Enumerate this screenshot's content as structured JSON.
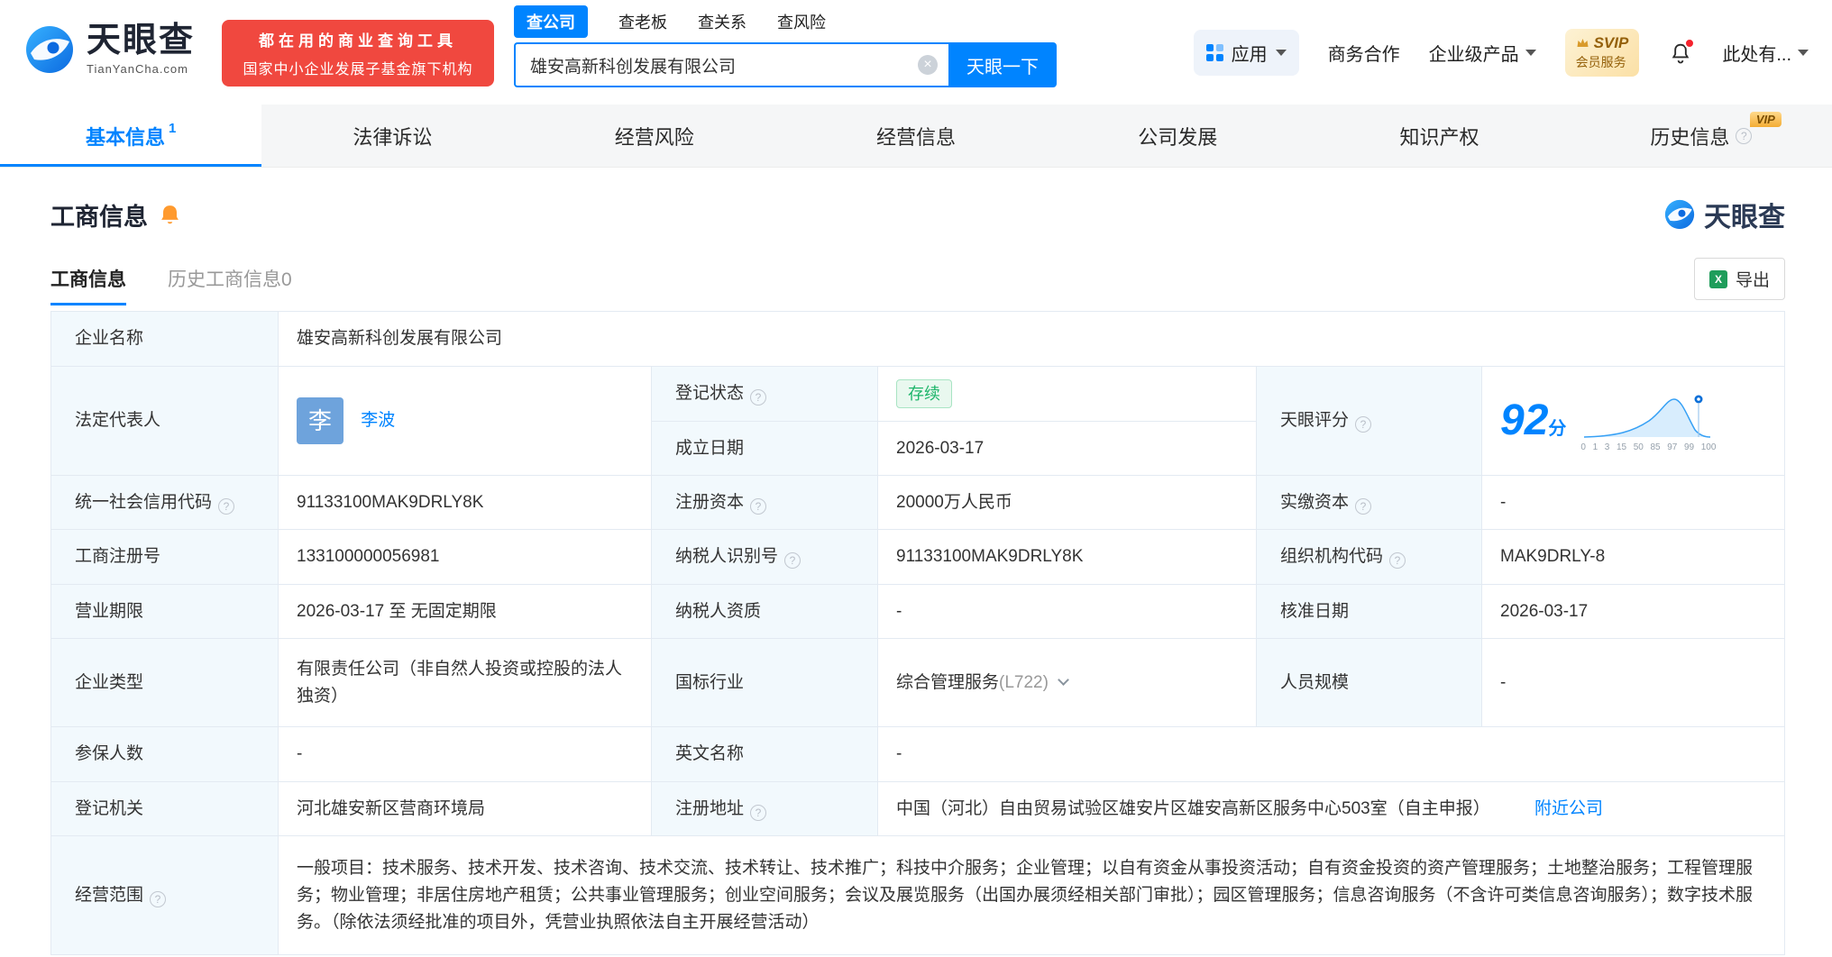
{
  "brand": {
    "name_cn": "天眼查",
    "name_en": "TianYanCha.com",
    "slogan_line1": "都在用的商业查询工具",
    "slogan_line2": "国家中小企业发展子基金旗下机构"
  },
  "search": {
    "tabs": [
      {
        "label": "查公司"
      },
      {
        "label": "查老板"
      },
      {
        "label": "查关系"
      },
      {
        "label": "查风险"
      }
    ],
    "value": "雄安高新科创发展有限公司",
    "button": "天眼一下"
  },
  "topnav": {
    "apps": "应用",
    "cooperation": "商务合作",
    "enterprise": "企业级产品",
    "svip_top": "SVIP",
    "svip_bottom": "会员服务",
    "user": "此处有..."
  },
  "tabs": {
    "items": [
      {
        "label": "基本信息",
        "count": "1"
      },
      {
        "label": "法律诉讼"
      },
      {
        "label": "经营风险"
      },
      {
        "label": "经营信息"
      },
      {
        "label": "公司发展"
      },
      {
        "label": "知识产权"
      },
      {
        "label": "历史信息",
        "vip": "VIP"
      }
    ]
  },
  "section": {
    "title": "工商信息",
    "brand_mark": "天眼查",
    "subtab_active": "工商信息",
    "subtab_history": "历史工商信息",
    "subtab_history_count": "0",
    "export": "导出"
  },
  "biz": {
    "company_name_label": "企业名称",
    "company_name": "雄安高新科创发展有限公司",
    "legal_rep_label": "法定代表人",
    "legal_rep_avatar": "李",
    "legal_rep": "李波",
    "reg_status_label": "登记状态",
    "reg_status": "存续",
    "establish_label": "成立日期",
    "establish_date": "2026-03-17",
    "score_label": "天眼评分",
    "score": "92",
    "score_unit": "分",
    "score_ticks": [
      "0",
      "1",
      "3",
      "15",
      "50",
      "85",
      "97",
      "99",
      "100"
    ],
    "credit_code_label": "统一社会信用代码",
    "credit_code": "91133100MAK9DRLY8K",
    "reg_capital_label": "注册资本",
    "reg_capital": "20000万人民币",
    "paid_capital_label": "实缴资本",
    "paid_capital": "-",
    "reg_number_label": "工商注册号",
    "reg_number": "133100000056981",
    "taxpayer_id_label": "纳税人识别号",
    "taxpayer_id": "91133100MAK9DRLY8K",
    "org_code_label": "组织机构代码",
    "org_code": "MAK9DRLY-8",
    "term_label": "营业期限",
    "term": "2026-03-17 至 无固定期限",
    "taxpayer_quality_label": "纳税人资质",
    "taxpayer_quality": "-",
    "approval_date_label": "核准日期",
    "approval_date": "2026-03-17",
    "company_type_label": "企业类型",
    "company_type": "有限责任公司（非自然人投资或控股的法人独资）",
    "industry_label": "国标行业",
    "industry": "综合管理服务",
    "industry_code": "(L722)",
    "staff_size_label": "人员规模",
    "staff_size": "-",
    "insured_label": "参保人数",
    "insured": "-",
    "english_name_label": "英文名称",
    "english_name": "-",
    "registry_label": "登记机关",
    "registry": "河北雄安新区营商环境局",
    "address_label": "注册地址",
    "address": "中国（河北）自由贸易试验区雄安片区雄安高新区服务中心503室（自主申报）",
    "nearby": "附近公司",
    "scope_label": "经营范围",
    "scope": "一般项目：技术服务、技术开发、技术咨询、技术交流、技术转让、技术推广；科技中介服务；企业管理；以自有资金从事投资活动；自有资金投资的资产管理服务；土地整治服务；工程管理服务；物业管理；非居住房地产租赁；公共事业管理服务；创业空间服务；会议及展览服务（出国办展须经相关部门审批）；园区管理服务；信息咨询服务（不含许可类信息咨询服务）；数字技术服务。（除依法须经批准的项目外，凭营业执照依法自主开展经营活动）"
  },
  "colors": {
    "primary": "#0084ff",
    "status_green": "#1db56a",
    "badge_red": "#f0483f",
    "label_bg": "#f2f9fd"
  }
}
